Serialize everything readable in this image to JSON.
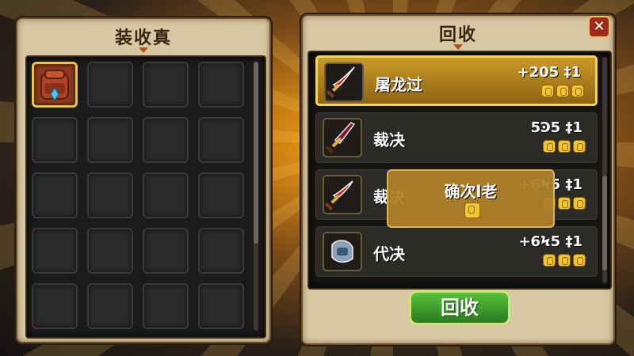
{
  "left_panel": {
    "title": "装收真"
  },
  "right_panel": {
    "title": "回收",
    "items": [
      {
        "name": "屠龙过",
        "amount": "+205 ‡1",
        "icon": "red-scimitar-icon"
      },
      {
        "name": "裁决",
        "amount": "5Ͽ5 ‡1",
        "icon": "crimson-blade-icon"
      },
      {
        "name": "裁决",
        "amount": "+6Ϟ5 ‡1",
        "icon": "crimson-sword-icon"
      },
      {
        "name": "代决",
        "amount": "+6Ϟ5 ‡1",
        "icon": "steel-gauntlet-icon"
      }
    ]
  },
  "confirm_popup": {
    "label": "确次l老"
  },
  "recycle_button": {
    "label": "回收"
  },
  "close_button": {
    "label": "✕"
  },
  "colors": {
    "gold": "#f2c531",
    "green": "#3ea02a",
    "panel": "#d7c7a3"
  }
}
